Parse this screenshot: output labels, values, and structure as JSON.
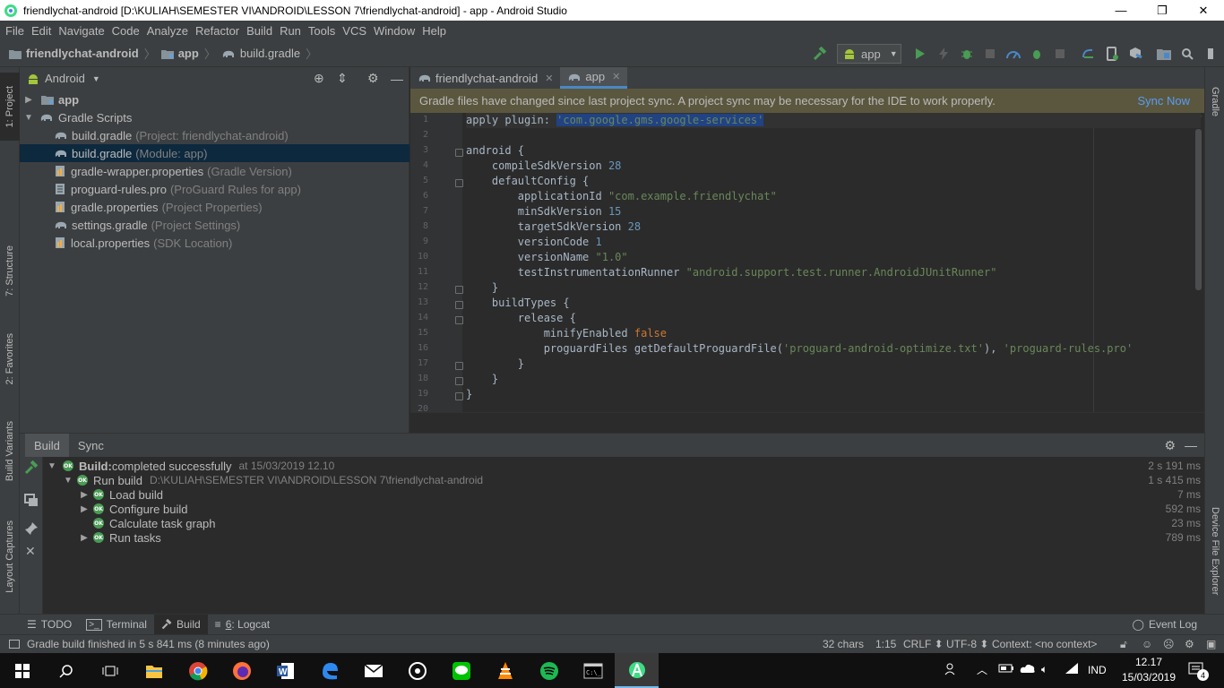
{
  "window": {
    "title": "friendlychat-android [D:\\KULIAH\\SEMESTER VI\\ANDROID\\LESSON 7\\friendlychat-android] - app - Android Studio",
    "minimize": "—",
    "restore": "❐",
    "close": "✕"
  },
  "menu": [
    "File",
    "Edit",
    "Navigate",
    "Code",
    "Analyze",
    "Refactor",
    "Build",
    "Run",
    "Tools",
    "VCS",
    "Window",
    "Help"
  ],
  "navbar": {
    "crumbs": [
      "friendlychat-android",
      "app",
      "build.gradle"
    ],
    "run_config": "app"
  },
  "left_tool_tabs": {
    "project": "1: Project",
    "structure": "7: Structure",
    "favorites": "2: Favorites",
    "build_variants": "Build Variants",
    "layout_captures": "Layout Captures"
  },
  "right_tool_tabs": {
    "gradle": "Gradle",
    "device_file_explorer": "Device File Explorer"
  },
  "project_panel": {
    "view": "Android",
    "tree": [
      {
        "label": "app",
        "hint": "",
        "bold": true
      },
      {
        "label": "Gradle Scripts",
        "hint": ""
      },
      {
        "label": "build.gradle",
        "hint": "(Project: friendlychat-android)"
      },
      {
        "label": "build.gradle",
        "hint": "(Module: app)"
      },
      {
        "label": "gradle-wrapper.properties",
        "hint": "(Gradle Version)"
      },
      {
        "label": "proguard-rules.pro",
        "hint": "(ProGuard Rules for app)"
      },
      {
        "label": "gradle.properties",
        "hint": "(Project Properties)"
      },
      {
        "label": "settings.gradle",
        "hint": "(Project Settings)"
      },
      {
        "label": "local.properties",
        "hint": "(SDK Location)"
      }
    ]
  },
  "editor": {
    "tabs": [
      "friendlychat-android",
      "app"
    ],
    "notification": "Gradle files have changed since last project sync. A project sync may be necessary for the IDE to work properly.",
    "sync_link": "Sync Now",
    "line_numbers": [
      "1",
      "2",
      "3",
      "4",
      "5",
      "6",
      "7",
      "8",
      "9",
      "10",
      "11",
      "12",
      "13",
      "14",
      "15",
      "16",
      "17",
      "18",
      "19",
      "20"
    ],
    "code": {
      "l1_kw": "apply plugin: ",
      "l1_str": "'com.google.gms.google-services'",
      "l3": "android {",
      "l4_kw": "    compileSdkVersion ",
      "l4_num": "28",
      "l5": "    defaultConfig {",
      "l6_kw": "        applicationId ",
      "l6_str": "\"com.example.friendlychat\"",
      "l7_kw": "        minSdkVersion ",
      "l7_num": "15",
      "l8_kw": "        targetSdkVersion ",
      "l8_num": "28",
      "l9_kw": "        versionCode ",
      "l9_num": "1",
      "l10_kw": "        versionName ",
      "l10_str": "\"1.0\"",
      "l11_kw": "        testInstrumentationRunner ",
      "l11_str": "\"android.support.test.runner.AndroidJUnitRunner\"",
      "l12": "    }",
      "l13": "    buildTypes {",
      "l14": "        release {",
      "l15_kw": "            minifyEnabled ",
      "l15_bool": "false",
      "l16_kw": "            proguardFiles getDefaultProguardFile(",
      "l16_str1": "'proguard-android-optimize.txt'",
      "l16_mid": "), ",
      "l16_str2": "'proguard-rules.pro'",
      "l17": "        }",
      "l18": "    }",
      "l19": "}"
    }
  },
  "build_panel": {
    "tabs": [
      "Build",
      "Sync"
    ],
    "rows": [
      {
        "label": "Build:",
        "label_rest": " completed successfully",
        "detail": "at 15/03/2019 12.10",
        "time": "2 s 191 ms"
      },
      {
        "label": "Run build",
        "detail": "D:\\KULIAH\\SEMESTER VI\\ANDROID\\LESSON 7\\friendlychat-android",
        "time": "1 s 415 ms"
      },
      {
        "label": "Load build",
        "detail": "",
        "time": "7 ms"
      },
      {
        "label": "Configure build",
        "detail": "",
        "time": "592 ms"
      },
      {
        "label": "Calculate task graph",
        "detail": "",
        "time": "23 ms"
      },
      {
        "label": "Run tasks",
        "detail": "",
        "time": "789 ms"
      }
    ]
  },
  "bottom_tabs": {
    "todo": "TODO",
    "terminal": "Terminal",
    "build": "Build",
    "logcat_num": "6",
    "logcat": ": Logcat",
    "event_log": "Event Log"
  },
  "status_bar": {
    "message": "Gradle build finished in 5 s 841 ms (8 minutes ago)",
    "chars": "32 chars",
    "position": "1:15",
    "line_sep": "CRLF ⬍",
    "encoding": "UTF-8 ⬍",
    "context": "Context: <no context>"
  },
  "taskbar": {
    "language": "IND",
    "time": "12.17",
    "date": "15/03/2019",
    "notifications": "4"
  }
}
